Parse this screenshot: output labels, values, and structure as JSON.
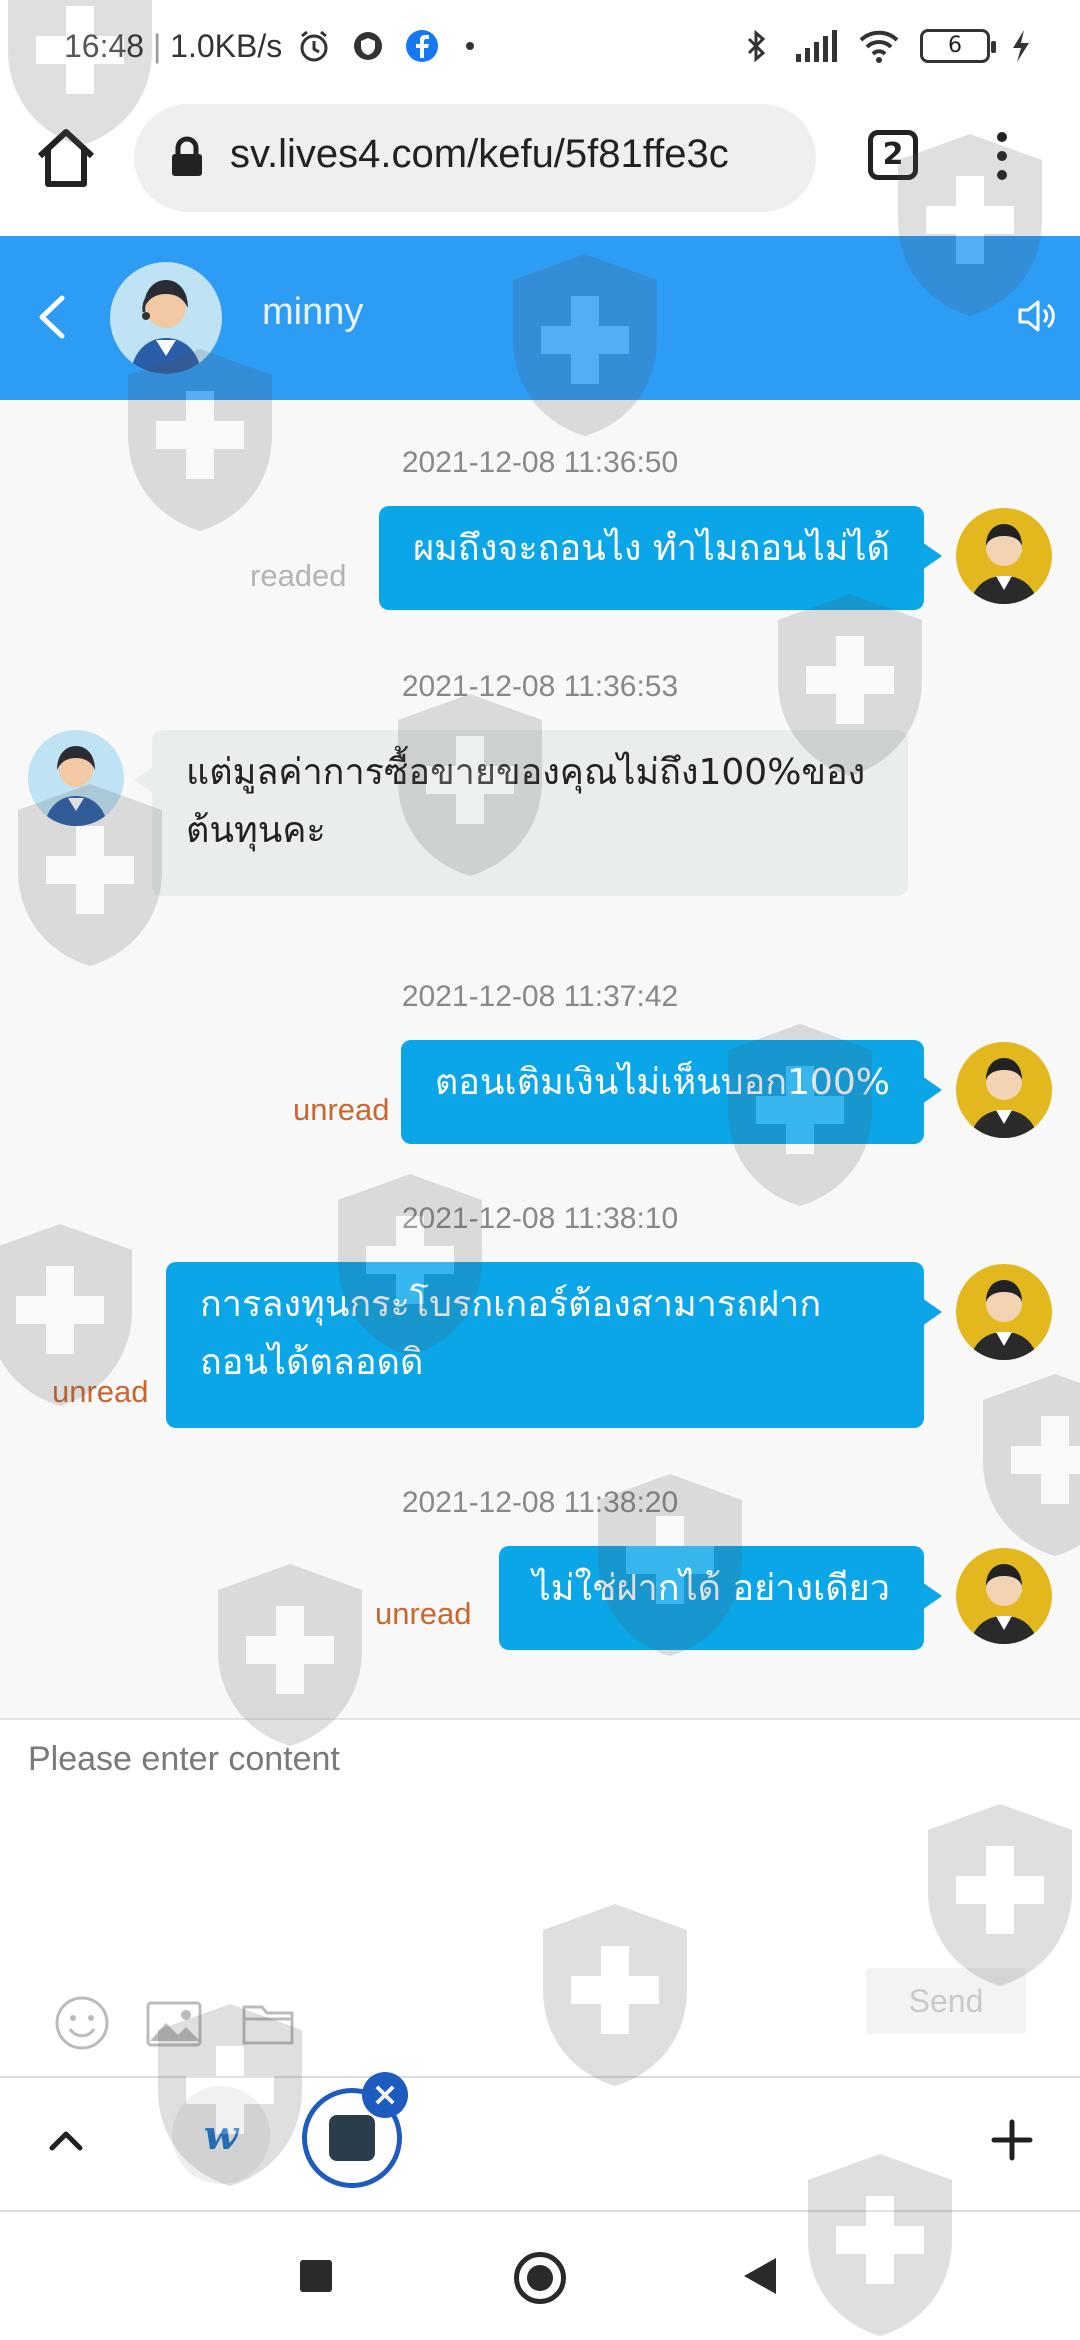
{
  "status_bar": {
    "time": "16:48",
    "speed": "1.0KB/s",
    "battery": "6"
  },
  "browser": {
    "url": "sv.lives4.com/kefu/5f81ffe3c",
    "tab_count": "2"
  },
  "chat": {
    "agent_name": "minny",
    "messages": [
      {
        "time": "2021-12-08 11:36:50",
        "from": "user",
        "text": "ผมถึงจะถอนไง ทำไมถอนไม่ได้",
        "status": "readed"
      },
      {
        "time": "2021-12-08 11:36:53",
        "from": "agent",
        "text_line1": "แต่มูลค่าการซื้อขายของคุณไม่ถึง100%ของ",
        "text_line2": "ต้นทุนคะ"
      },
      {
        "time": "2021-12-08 11:37:42",
        "from": "user",
        "text": "ตอนเติมเงินไม่เห็นบอก100%",
        "status": "unread"
      },
      {
        "time": "2021-12-08 11:38:10",
        "from": "user",
        "text_line1": "การลงทุนกระโบรกเกอร์ต้องสามารถฝาก",
        "text_line2": "ถอนได้ตลอดดิ",
        "status": "unread"
      },
      {
        "time": "2021-12-08 11:38:20",
        "from": "user",
        "text": "ไม่ใช่ฝากได้ อย่างเดียว",
        "status": "unread"
      }
    ]
  },
  "composer": {
    "placeholder": "Please enter content",
    "send_label": "Send"
  },
  "bottom_bar": {
    "w_label": "w"
  }
}
